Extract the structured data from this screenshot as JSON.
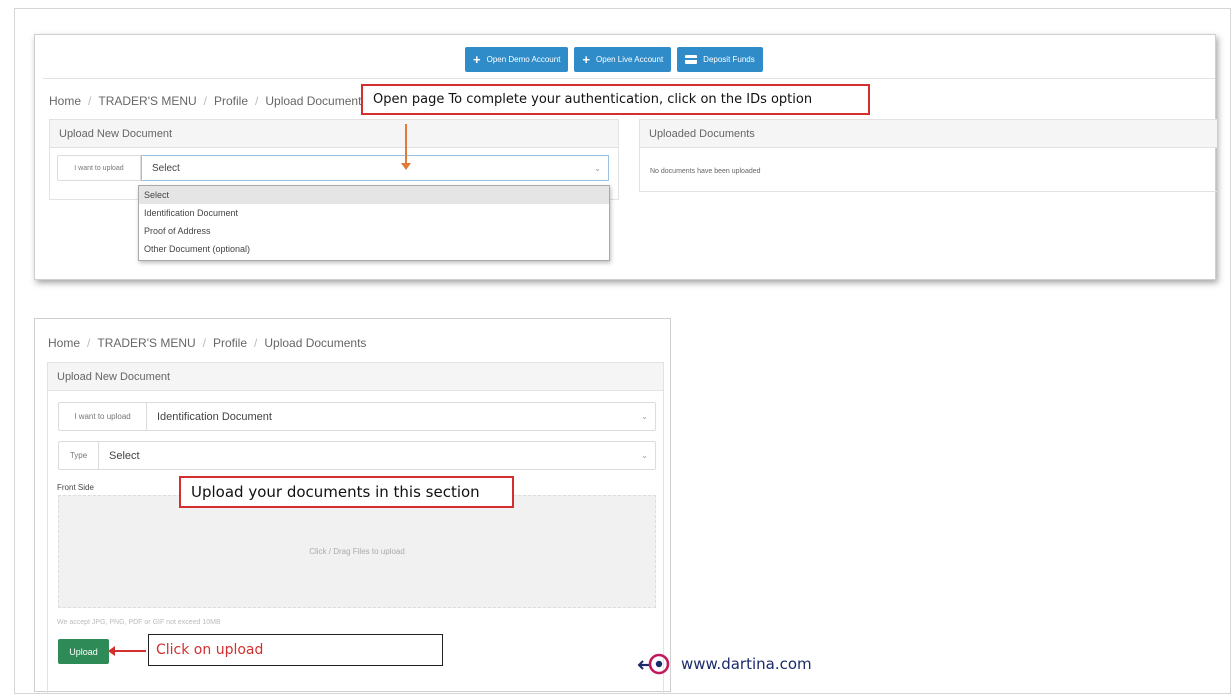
{
  "top_buttons": [
    {
      "label": "Open Demo Account",
      "icon": "plus-icon"
    },
    {
      "label": "Open Live Account",
      "icon": "plus-icon"
    },
    {
      "label": "Deposit Funds",
      "icon": "card-icon"
    }
  ],
  "breadcrumb": [
    "Home",
    "TRADER'S MENU",
    "Profile",
    "Upload Documents"
  ],
  "breadcrumb_sep": "/",
  "upload_panel": {
    "title": "Upload New Document",
    "want_label": "I want to upload",
    "select_value": "Select",
    "dropdown_options": [
      "Select",
      "Identification Document",
      "Proof of Address",
      "Other Document (optional)"
    ]
  },
  "uploaded_panel": {
    "title": "Uploaded Documents",
    "empty_message": "No documents have been uploaded"
  },
  "callout_open": "Open page To complete your authentication, click on the IDs option",
  "upload_panel2": {
    "title": "Upload New Document",
    "want_label": "I want to upload",
    "want_value": "Identification Document",
    "type_label": "Type",
    "type_value": "Select",
    "front_label": "Front Side",
    "dropzone_text": "Click / Drag Files to upload",
    "accept_note": "We accept JPG, PNG, PDF or GIF not exceed 10MB",
    "upload_button": "Upload"
  },
  "callout_section": "Upload your documents in this section",
  "callout_click": "Click on upload",
  "brand": {
    "text": "www.dartina.com",
    "accent": "#c2185b",
    "text_color": "#1b2a6b"
  },
  "colors": {
    "primary_button": "#2f8cc9",
    "upload_button": "#2e8b57",
    "callout_border": "#d32f2f",
    "arrow_orange": "#e07b39"
  }
}
